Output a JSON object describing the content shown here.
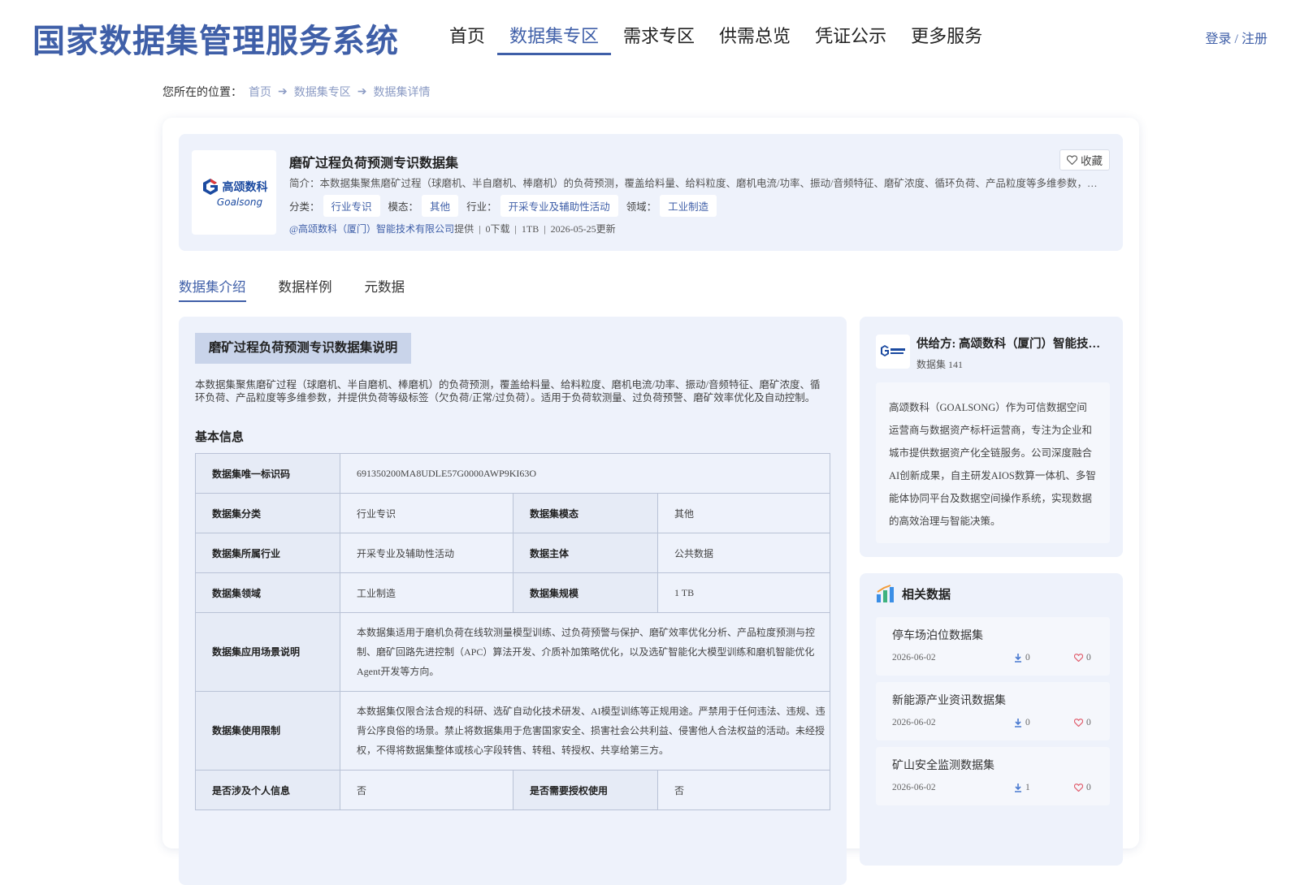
{
  "header": {
    "brand": "国家数据集管理服务系统",
    "nav": [
      "首页",
      "数据集专区",
      "需求专区",
      "供需总览",
      "凭证公示",
      "更多服务"
    ],
    "active_nav": "数据集专区",
    "auth": "登录 / 注册"
  },
  "breadcrumb": {
    "prefix": "您所在的位置：",
    "items": [
      "首页",
      "数据集专区",
      "数据集详情"
    ]
  },
  "dataset": {
    "logo_cn": "高颂数科",
    "logo_en": "Goalsong",
    "title": "磨矿过程负荷预测专识数据集",
    "brief": "简介：本数据集聚焦磨矿过程（球磨机、半自磨机、棒磨机）的负荷预测，覆盖给料量、给料粒度、磨机电流/功率、振动/音频特征、磨矿浓度、循环负荷、产品粒度等多维参数，并提供负荷等级标签（欠负荷/正常/过负荷）。适用于负荷软测量、过负荷预警、磨矿效率优化及自动控制。",
    "fav_label": "收藏",
    "tags": [
      {
        "label": "分类：",
        "value": "行业专识"
      },
      {
        "label": "模态：",
        "value": "其他"
      },
      {
        "label": "行业：",
        "value": "开采专业及辅助性活动"
      },
      {
        "label": "领域：",
        "value": "工业制造"
      }
    ],
    "provider": "@高颂数科（厦门）智能技术有限公司",
    "provided_suffix": "提供",
    "downloads": "0下载",
    "size": "1TB",
    "updated": "2026-05-25更新"
  },
  "tabs": [
    "数据集介绍",
    "数据样例",
    "元数据"
  ],
  "active_tab": "数据集介绍",
  "intro": {
    "section_title": "磨矿过程负荷预测专识数据集说明",
    "description": "本数据集聚焦磨矿过程（球磨机、半自磨机、棒磨机）的负荷预测，覆盖给料量、给料粒度、磨机电流/功率、振动/音频特征、磨矿浓度、循环负荷、产品粒度等多维参数，并提供负荷等级标签（欠负荷/正常/过负荷）。适用于负荷软测量、过负荷预警、磨矿效率优化及自动控制。",
    "basic_title": "基本信息",
    "uid_label": "数据集唯一标识码",
    "uid": "691350200MA8UDLE57G0000AWP9KI63O",
    "category_label": "数据集分类",
    "category": "行业专识",
    "modality_label": "数据集模态",
    "modality": "其他",
    "industry_label": "数据集所属行业",
    "industry": "开采专业及辅助性活动",
    "subject_label": "数据主体",
    "subject": "公共数据",
    "domain_label": "数据集领域",
    "domain": "工业制造",
    "scale_label": "数据集规模",
    "scale": "1 TB",
    "scenario_label": "数据集应用场景说明",
    "scenario": "本数据集适用于磨机负荷在线软测量模型训练、过负荷预警与保护、磨矿效率优化分析、产品粒度预测与控制、磨矿回路先进控制（APC）算法开发、介质补加策略优化，以及选矿智能化大模型训练和磨机智能优化Agent开发等方向。",
    "restriction_label": "数据集使用限制",
    "restriction": "本数据集仅限合法合规的科研、选矿自动化技术研发、AI模型训练等正规用途。严禁用于任何违法、违规、违背公序良俗的场景。禁止将数据集用于危害国家安全、损害社会公共利益、侵害他人合法权益的活动。未经授权，不得将数据集整体或核心字段转售、转租、转授权、共享给第三方。",
    "personal_label": "是否涉及个人信息",
    "personal": "否",
    "auth_label": "是否需要授权使用",
    "auth": "否"
  },
  "provider_panel": {
    "name": "供给方: 高颂数科（厦门）智能技术有限公司",
    "count": "数据集 141",
    "about": "高颂数科（GOALSONG）作为可信数据空间运营商与数据资产标杆运营商，专注为企业和城市提供数据资产化全链服务。公司深度融合AI创新成果，自主研发AIOS数算一体机、多智能体协同平台及数据空间操作系统，实现数据的高效治理与智能决策。"
  },
  "related": {
    "title": "相关数据",
    "items": [
      {
        "name": "停车场泊位数据集",
        "date": "2026-06-02",
        "downloads": "0",
        "likes": "0"
      },
      {
        "name": "新能源产业资讯数据集",
        "date": "2026-06-02",
        "downloads": "0",
        "likes": "0"
      },
      {
        "name": "矿山安全监测数据集",
        "date": "2026-06-02",
        "downloads": "1",
        "likes": "0"
      }
    ]
  },
  "colors": {
    "accent": "#3f5fa8",
    "panel": "#eef2fb",
    "like": "#e05a6a",
    "download": "#4a7ad0"
  },
  "icons": [
    "heart-icon",
    "arrow-right-icon",
    "download-icon",
    "bar-chart-icon",
    "goalsong-logo"
  ]
}
